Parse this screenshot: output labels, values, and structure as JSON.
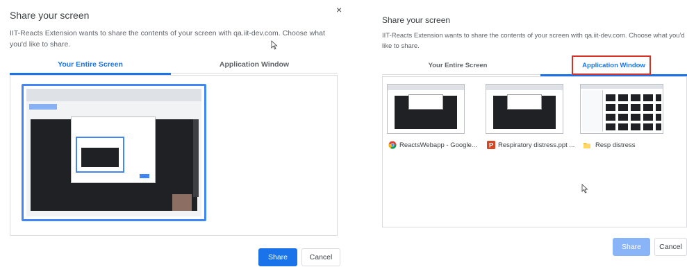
{
  "left_dialog": {
    "title": "Share your screen",
    "description": "IIT-Reacts Extension wants to share the contents of your screen with qa.iit-dev.com. Choose what you'd like to share.",
    "close_glyph": "×",
    "tabs": [
      {
        "label": "Your Entire Screen",
        "selected": true
      },
      {
        "label": "Application Window",
        "selected": false
      }
    ],
    "share_label": "Share",
    "cancel_label": "Cancel"
  },
  "right_dialog": {
    "title": "Share your screen",
    "description": "IIT-Reacts Extension wants to share the contents of your screen with qa.iit-dev.com. Choose what you'd like to share.",
    "tabs": [
      {
        "label": "Your Entire Screen",
        "selected": false
      },
      {
        "label": "Application Window",
        "selected": true
      }
    ],
    "windows": [
      {
        "label": "ReactsWebapp - Google...",
        "icon": "chrome-icon"
      },
      {
        "label": "Respiratory distress.ppt ...",
        "icon": "powerpoint-icon"
      },
      {
        "label": "Resp distress",
        "icon": "folder-icon"
      }
    ],
    "share_label": "Share",
    "cancel_label": "Cancel"
  },
  "colors": {
    "accent": "#1a73e8",
    "highlight": "#d93025"
  }
}
